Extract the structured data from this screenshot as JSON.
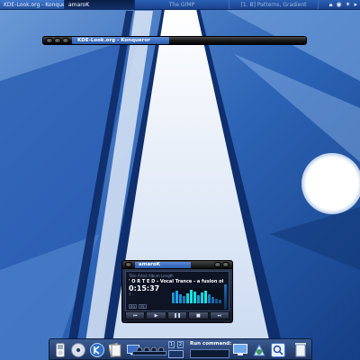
{
  "taskbar": {
    "konqueror_task": "KDE-Look.org - Konqueror",
    "amarok_task": "amaroK",
    "gimp_task": "The GIMP",
    "slideshow_task": "[1. B] Patterns, Gradient"
  },
  "konqueror": {
    "title": "KDE-Look.org - Konqueror"
  },
  "amarok": {
    "title": "amaroK",
    "scrolling_text": "Title Artist Album Length",
    "track": "' O R T E D - Vocal Trance - a fusion of trance, da",
    "time": "0:15:37",
    "kbps": "? -",
    "toggle_eq": "EQ",
    "toggle_pl": "PL",
    "controls": {
      "prev": "⏮",
      "play": "▶",
      "pause": "❚❚",
      "stop": "■",
      "next": "⏭"
    }
  },
  "dock": {
    "pager": [
      "1",
      "2"
    ],
    "run_command_label": "Run command:"
  },
  "icons": {
    "kmenu": "kde-logo-icon",
    "media": "ipod-icon",
    "cd": "cd-icon",
    "trash": "trash-icon"
  },
  "colors": {
    "wallpaper_dark": "#153f86",
    "wallpaper_light": "#6c9ad6",
    "title_active": "#3f77cf"
  }
}
